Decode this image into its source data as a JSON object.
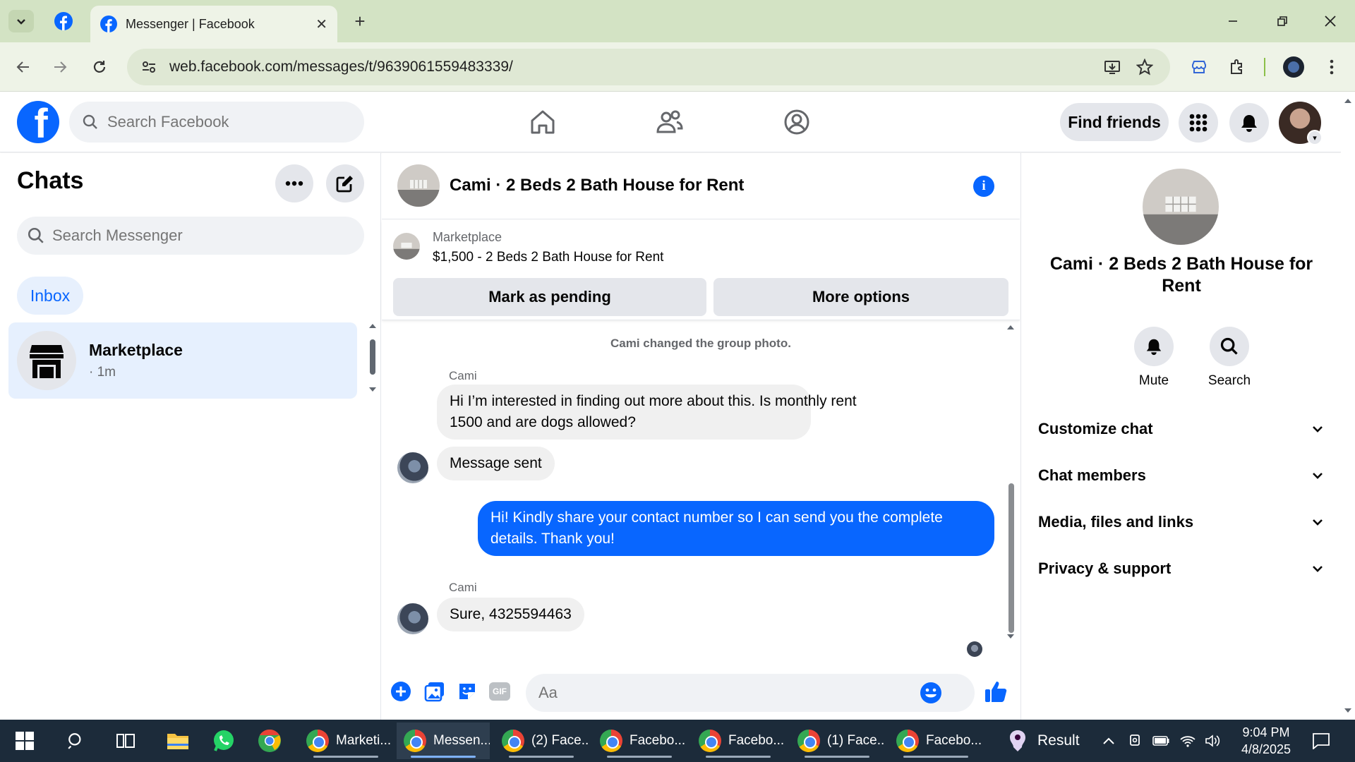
{
  "browser": {
    "tab_title": "Messenger | Facebook",
    "url": "web.facebook.com/messages/t/9639061559483339/"
  },
  "header": {
    "search_placeholder": "Search Facebook",
    "find_friends": "Find friends"
  },
  "chats": {
    "title": "Chats",
    "search_placeholder": "Search Messenger",
    "filter": "Inbox",
    "items": [
      {
        "name": "Marketplace",
        "time": "· 1m"
      }
    ]
  },
  "conversation": {
    "title": "Cami · 2 Beds 2 Bath House for Rent",
    "marketplace_label": "Marketplace",
    "listing": "$1,500 - 2 Beds 2 Bath House for Rent",
    "mark_pending": "Mark as pending",
    "more_options": "More options",
    "system_message": "Cami changed the group photo.",
    "messages": [
      {
        "sender": "Cami",
        "text_line1": "Hi I’m interested in finding out more about this. Is monthly rent",
        "text_line2": "1500 and are dogs allowed?"
      },
      {
        "text": "Message sent"
      },
      {
        "text_line1": "Hi! Kindly share your contact number so I can send you the complete",
        "text_line2": "details. Thank you!"
      },
      {
        "sender": "Cami",
        "text": "Sure, 4325594463"
      }
    ],
    "composer_placeholder": "Aa",
    "gif_label": "GIF"
  },
  "details": {
    "name": "Cami · 2 Beds 2 Bath House for Rent",
    "actions": [
      {
        "label": "Mute",
        "icon": "bell-icon"
      },
      {
        "label": "Search",
        "icon": "search-icon"
      }
    ],
    "sections": [
      {
        "label": "Customize chat"
      },
      {
        "label": "Chat members"
      },
      {
        "label": "Media, files and links"
      },
      {
        "label": "Privacy & support"
      }
    ]
  },
  "taskbar": {
    "apps": [
      {
        "label": "Marketi..."
      },
      {
        "label": "Messen..."
      },
      {
        "label": "(2) Face..."
      },
      {
        "label": "Facebo..."
      },
      {
        "label": "Facebo..."
      },
      {
        "label": "(1) Face..."
      },
      {
        "label": "Facebo..."
      }
    ],
    "result_label": "Result",
    "time": "9:04 PM",
    "date": "4/8/2025"
  },
  "colors": {
    "facebook_blue": "#0866ff",
    "tab_strip": "#d3e3c4",
    "taskbar": "#1c2b3a"
  }
}
